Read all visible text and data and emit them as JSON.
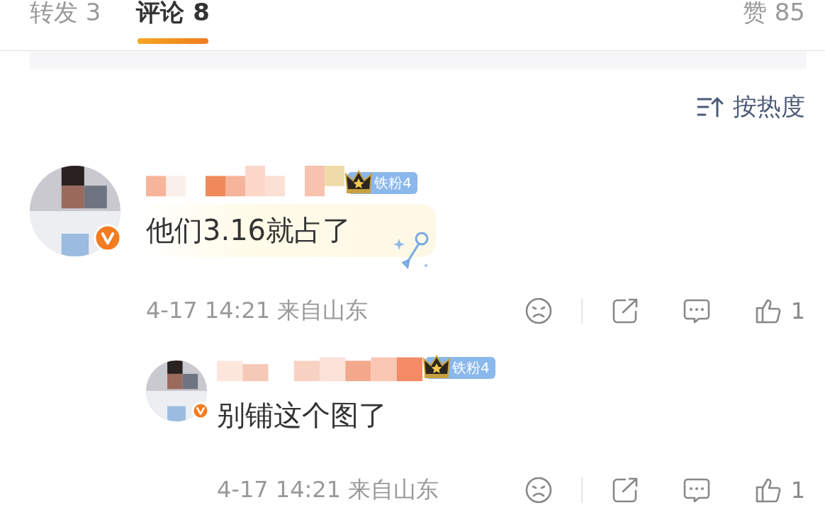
{
  "tabs": [
    {
      "label": "转发 3",
      "selected": false
    },
    {
      "label": "评论 8",
      "selected": true
    },
    {
      "label": "赞 85",
      "selected": false
    }
  ],
  "sort": {
    "label": "按热度"
  },
  "comments": [
    {
      "badge": "铁粉4",
      "text": "他们3.16就占了",
      "decorated": true,
      "time": "4-17 14:21",
      "location": "来自山东",
      "likes": "1",
      "replies": [
        {
          "badge": "铁粉4",
          "text": "别铺这个图了",
          "decorated": false,
          "time": "4-17 14:21",
          "location": "来自山东",
          "likes": "1"
        }
      ]
    }
  ]
}
